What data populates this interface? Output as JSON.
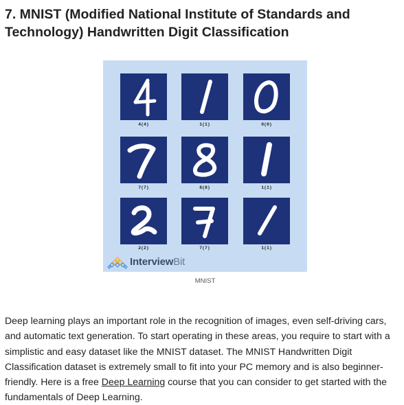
{
  "heading": "7. MNIST (Modified National Institute of Standards and Technology) Handwritten Digit Classification",
  "figure": {
    "cells": [
      {
        "label": "4(4)",
        "digit": "4"
      },
      {
        "label": "1(1)",
        "digit": "1"
      },
      {
        "label": "0(0)",
        "digit": "0"
      },
      {
        "label": "7(7)",
        "digit": "7"
      },
      {
        "label": "8(8)",
        "digit": "8"
      },
      {
        "label": "1(1)",
        "digit": "1"
      },
      {
        "label": "2(2)",
        "digit": "2"
      },
      {
        "label": "7(7)",
        "digit": "7"
      },
      {
        "label": "1(1)",
        "digit": "1"
      }
    ],
    "logo_primary": "Interview",
    "logo_secondary": "Bit",
    "logo_icon": "interviewbit-logo-icon",
    "caption": "MNIST",
    "colors": {
      "background": "#c7dcf3",
      "cell": "#1e327a",
      "stroke": "#ffffff"
    }
  },
  "paragraph": {
    "before_link": "Deep learning plays an important role in the recognition of images, even self-driving cars, and automatic text generation. To start operating in these areas, you require to start with a simplistic and easy dataset like the MNIST dataset. The MNIST Handwritten Digit Classification dataset is extremely small to fit into your PC memory and is also beginner-friendly. Here is a free ",
    "link_text": "Deep Learning",
    "after_link": " course that you can consider to get started with the fundamentals of Deep Learning."
  }
}
